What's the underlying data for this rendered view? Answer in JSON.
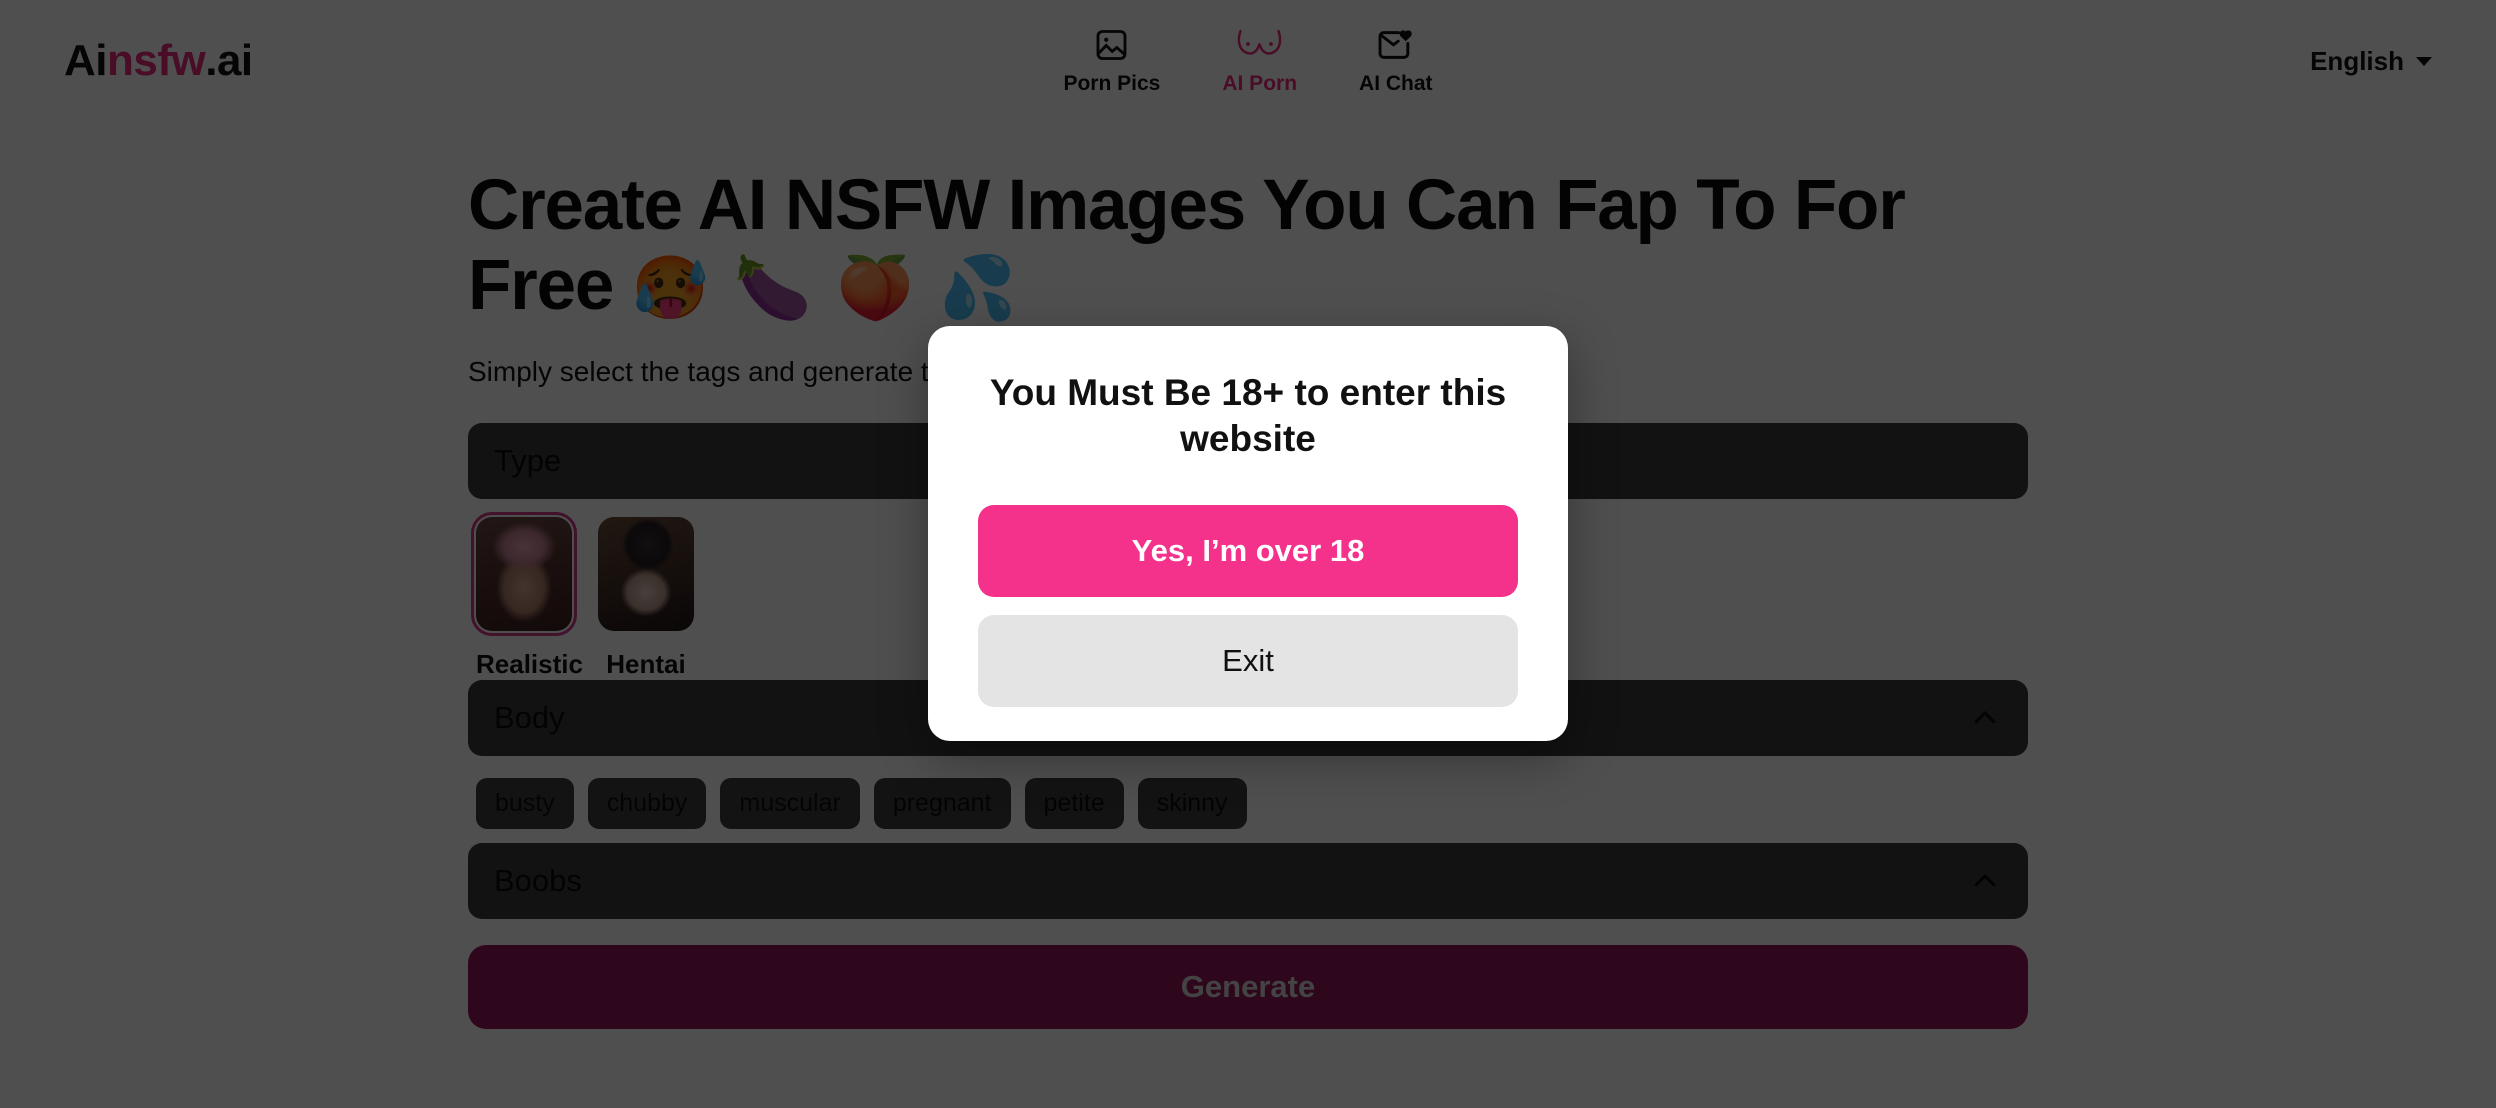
{
  "header": {
    "logo": {
      "part1": "Ai",
      "part2": "nsfw",
      "part3": ".ai"
    },
    "nav": [
      {
        "label": "Porn Pics",
        "icon": "image-icon",
        "active": false
      },
      {
        "label": "AI Porn",
        "icon": "boobs-icon",
        "active": true
      },
      {
        "label": "AI Chat",
        "icon": "chat-heart-icon",
        "active": false
      }
    ],
    "language": {
      "label": "English",
      "icon": "chevron-down-icon"
    }
  },
  "main": {
    "title": "Create AI NSFW Images You Can Fap To For Free",
    "title_emojis": "🥵 🍆 🍑 💦",
    "subtitle": "Simply select the tags and generate the AI girl exactly how you want her to be.",
    "sections": [
      {
        "title": "Type",
        "collapse_icon": "",
        "options": [
          {
            "label": "Realistic",
            "selected": true
          },
          {
            "label": "Hentai",
            "selected": false
          }
        ]
      },
      {
        "title": "Body",
        "collapse_icon": "chevron-up-icon",
        "tags": [
          "busty",
          "chubby",
          "muscular",
          "pregnant",
          "petite",
          "skinny"
        ]
      },
      {
        "title": "Boobs",
        "collapse_icon": "chevron-up-icon",
        "tags": []
      }
    ],
    "generate_label": "Generate"
  },
  "modal": {
    "title": "You Must Be 18+ to enter this website",
    "confirm_label": "Yes, I’m over 18",
    "exit_label": "Exit"
  },
  "colors": {
    "accent_pink": "#f4318b",
    "brand_pink": "#ec2a7f",
    "page_bg": "#2f2f2f",
    "panel_bg": "#3a3a3a",
    "generate_bg": "#95185a"
  }
}
